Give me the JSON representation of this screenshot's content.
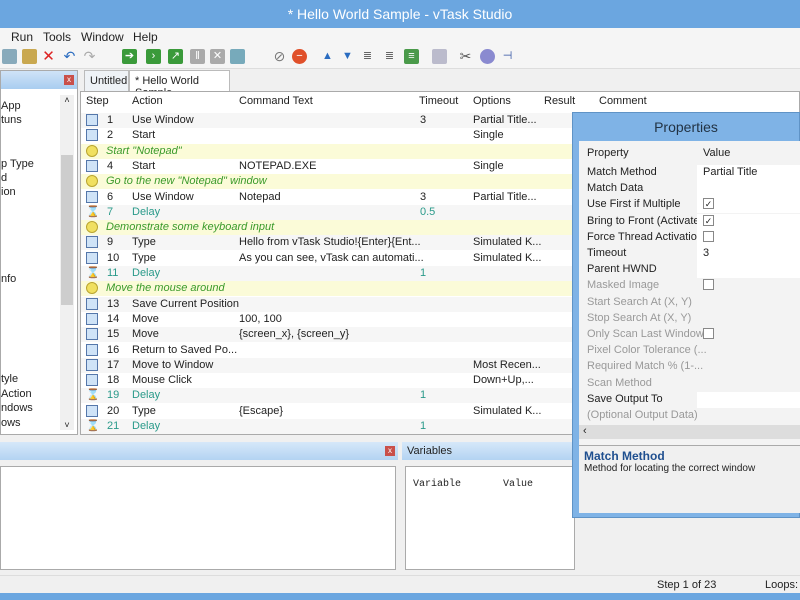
{
  "window": {
    "title": "* Hello World Sample - vTask Studio"
  },
  "menu": [
    "Run",
    "Tools",
    "Window",
    "Help"
  ],
  "left_panel": {
    "items": [
      "App",
      "tuns",
      "p Type",
      "d",
      "ion",
      "nfo",
      "tyle",
      "Action",
      "ndows",
      "ows"
    ]
  },
  "tabs": [
    "Untitled",
    "* Hello World Sample"
  ],
  "grid": {
    "columns": [
      "Step",
      "Action",
      "Command Text",
      "Timeout",
      "Options",
      "Result",
      "Comment"
    ],
    "rows": [
      {
        "type": "step",
        "icon": "window-icon",
        "step": "1",
        "action": "Use Window",
        "command": "",
        "timeout": "3",
        "options": "Partial Title..."
      },
      {
        "type": "step",
        "icon": "start-icon",
        "step": "2",
        "action": "Start",
        "command": "",
        "timeout": "",
        "options": "Single"
      },
      {
        "type": "comment",
        "text": "Start \"Notepad\""
      },
      {
        "type": "step",
        "icon": "start-icon",
        "step": "4",
        "action": "Start",
        "command": "NOTEPAD.EXE",
        "timeout": "",
        "options": "Single"
      },
      {
        "type": "comment",
        "text": "Go to the new \"Notepad\" window"
      },
      {
        "type": "step",
        "icon": "window-icon",
        "step": "6",
        "action": "Use Window",
        "command": "Notepad",
        "timeout": "3",
        "options": "Partial Title..."
      },
      {
        "type": "delay",
        "icon": "hourglass-icon",
        "step": "7",
        "action": "Delay",
        "command": "",
        "timeout": "0.5",
        "options": ""
      },
      {
        "type": "comment",
        "text": "Demonstrate some keyboard input"
      },
      {
        "type": "step",
        "icon": "keyboard-icon",
        "step": "9",
        "action": "Type",
        "command": "Hello from vTask Studio!{Enter}{Ent...",
        "timeout": "",
        "options": "Simulated K..."
      },
      {
        "type": "step",
        "icon": "keyboard-icon",
        "step": "10",
        "action": "Type",
        "command": "As you can see, vTask can automati...",
        "timeout": "",
        "options": "Simulated K..."
      },
      {
        "type": "delay",
        "icon": "hourglass-icon",
        "step": "11",
        "action": "Delay",
        "command": "",
        "timeout": "1",
        "options": ""
      },
      {
        "type": "comment",
        "text": "Move the mouse around"
      },
      {
        "type": "step",
        "icon": "mouse-icon",
        "step": "13",
        "action": "Save Current Position",
        "command": "",
        "timeout": "",
        "options": ""
      },
      {
        "type": "step",
        "icon": "mouse-move-icon",
        "step": "14",
        "action": "Move",
        "command": "100, 100",
        "timeout": "",
        "options": ""
      },
      {
        "type": "step",
        "icon": "mouse-move-icon",
        "step": "15",
        "action": "Move",
        "command": "{screen_x}, {screen_y}",
        "timeout": "",
        "options": ""
      },
      {
        "type": "step",
        "icon": "mouse-return-icon",
        "step": "16",
        "action": "Return to Saved Po...",
        "command": "",
        "timeout": "",
        "options": ""
      },
      {
        "type": "step",
        "icon": "move-window-icon",
        "step": "17",
        "action": "Move to Window",
        "command": "",
        "timeout": "",
        "options": "Most Recen..."
      },
      {
        "type": "step",
        "icon": "mouse-click-icon",
        "step": "18",
        "action": "Mouse Click",
        "command": "",
        "timeout": "",
        "options": "Down+Up,..."
      },
      {
        "type": "delay",
        "icon": "hourglass-icon",
        "step": "19",
        "action": "Delay",
        "command": "",
        "timeout": "1",
        "options": ""
      },
      {
        "type": "step",
        "icon": "keyboard-icon",
        "step": "20",
        "action": "Type",
        "command": "{Escape}",
        "timeout": "",
        "options": "Simulated K..."
      },
      {
        "type": "delay",
        "icon": "hourglass-icon",
        "step": "21",
        "action": "Delay",
        "command": "",
        "timeout": "1",
        "options": ""
      }
    ]
  },
  "variables": {
    "title": "Variables",
    "columns": [
      "Variable",
      "Value"
    ]
  },
  "properties": {
    "title": "Properties",
    "header": [
      "Property",
      "Value"
    ],
    "rows": [
      {
        "name": "Match Method",
        "value": "Partial Title",
        "enabled": true
      },
      {
        "name": "Match Data",
        "value": "",
        "enabled": true
      },
      {
        "name": "Use First if Multiple",
        "checkbox": true,
        "checked": true,
        "enabled": true
      },
      {
        "name": "Bring to Front (Activate)",
        "checkbox": true,
        "checked": true,
        "enabled": true
      },
      {
        "name": "Force Thread Activation",
        "checkbox": true,
        "checked": false,
        "enabled": true
      },
      {
        "name": "Timeout",
        "value": "3",
        "enabled": true
      },
      {
        "name": "Parent HWND",
        "value": "",
        "enabled": true
      },
      {
        "name": "Masked Image",
        "checkbox": true,
        "checked": false,
        "enabled": false
      },
      {
        "name": "Start Search At (X, Y)",
        "value": "",
        "enabled": false
      },
      {
        "name": "Stop Search At (X, Y)",
        "value": "",
        "enabled": false
      },
      {
        "name": "Only Scan Last Window",
        "checkbox": true,
        "checked": false,
        "enabled": false
      },
      {
        "name": "Pixel Color Tolerance (...",
        "value": "",
        "enabled": false
      },
      {
        "name": "Required Match % (1-...",
        "value": "",
        "enabled": false
      },
      {
        "name": "Scan Method",
        "value": "",
        "enabled": false
      },
      {
        "name": "Save Output To",
        "value": "",
        "enabled": true
      },
      {
        "name": "(Optional Output Data)",
        "value": "",
        "enabled": false
      }
    ],
    "desc_title": "Match Method",
    "desc_text": "Method for locating the correct window"
  },
  "status": {
    "step": "Step 1 of 23",
    "loops": "Loops:"
  }
}
